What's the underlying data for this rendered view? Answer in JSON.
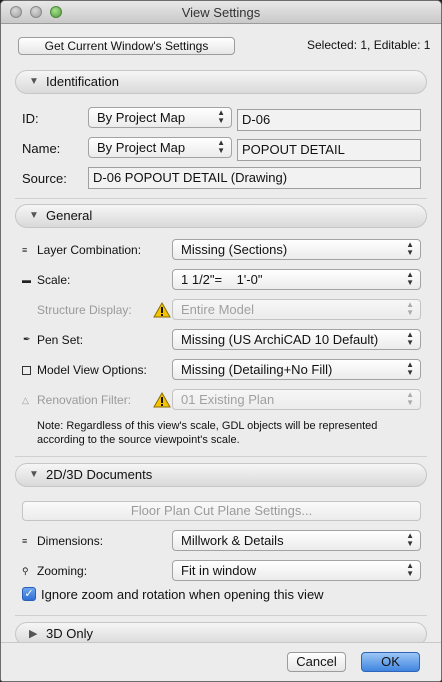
{
  "window": {
    "title": "View Settings"
  },
  "top": {
    "get_settings_label": "Get Current Window's Settings",
    "selection_status": "Selected: 1, Editable: 1"
  },
  "identification": {
    "header": "Identification",
    "id_label": "ID:",
    "id_popup": "By Project Map",
    "id_value": "D-06",
    "name_label": "Name:",
    "name_popup": "By Project Map",
    "name_value": "POPOUT DETAIL",
    "source_label": "Source:",
    "source_value": "D-06 POPOUT DETAIL (Drawing)"
  },
  "general": {
    "header": "General",
    "layer_label": "Layer Combination:",
    "layer_value": "Missing (Sections)",
    "scale_label": "Scale:",
    "scale_value": "1 1/2\"=    1'-0\"",
    "structure_label": "Structure Display:",
    "structure_value": "Entire Model",
    "penset_label": "Pen Set:",
    "penset_value": "Missing (US ArchiCAD 10 Default)",
    "mvo_label": "Model View Options:",
    "mvo_value": "Missing (Detailing+No Fill)",
    "renovation_label": "Renovation Filter:",
    "renovation_value": "01 Existing Plan",
    "note": "Note: Regardless of this view's scale, GDL objects will be represented according to the source viewpoint's scale."
  },
  "documents": {
    "header": "2D/3D Documents",
    "cut_plane_label": "Floor Plan Cut Plane Settings...",
    "dimensions_label": "Dimensions:",
    "dimensions_value": "Millwork & Details",
    "zooming_label": "Zooming:",
    "zooming_value": "Fit in window",
    "ignore_zoom_label": "Ignore zoom and rotation when opening this view",
    "ignore_zoom_checked": true
  },
  "only3d": {
    "header": "3D Only"
  },
  "footer": {
    "cancel_label": "Cancel",
    "ok_label": "OK"
  }
}
